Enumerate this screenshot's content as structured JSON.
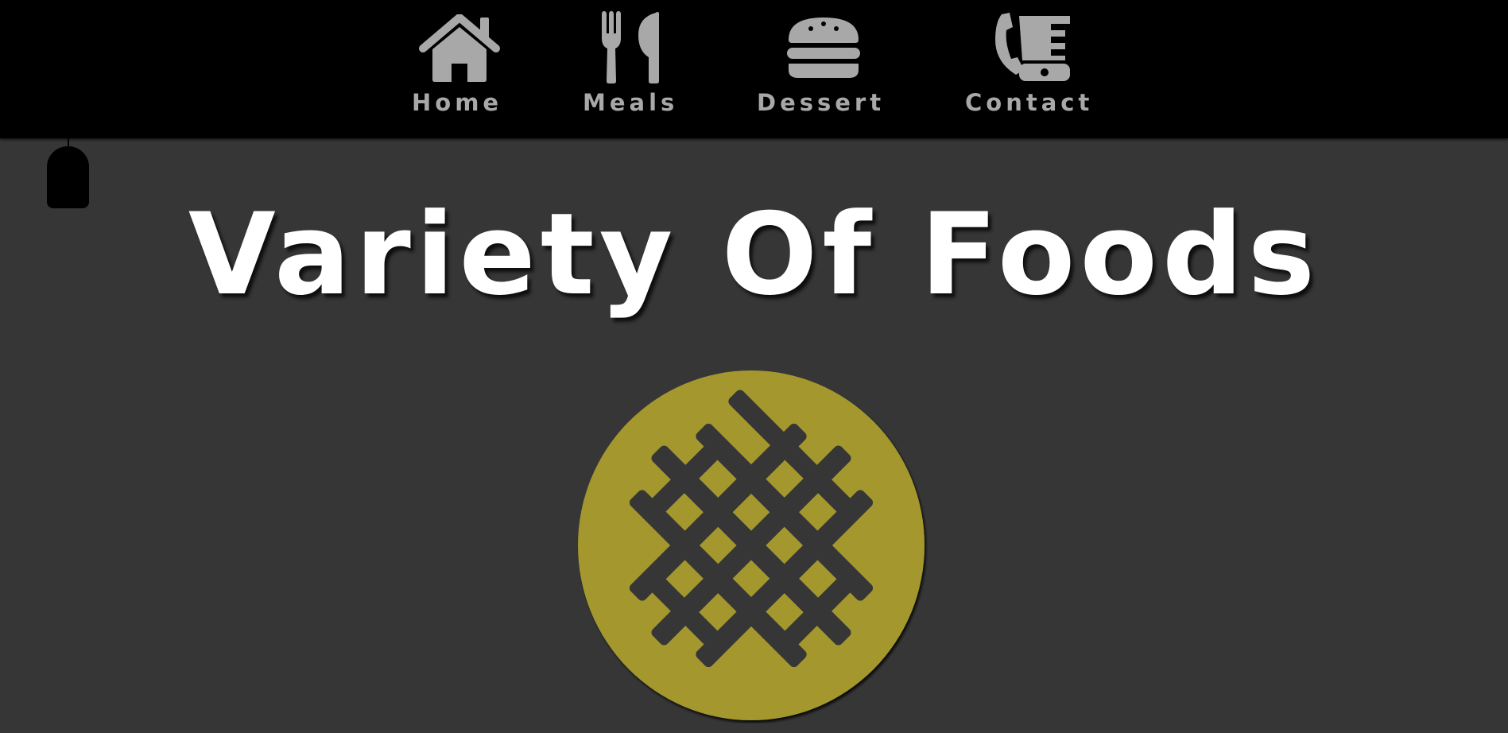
{
  "nav": {
    "items": [
      {
        "label": "Home",
        "icon": "home-icon"
      },
      {
        "label": "Meals",
        "icon": "fork-knife-icon"
      },
      {
        "label": "Dessert",
        "icon": "burger-icon"
      },
      {
        "label": "Contact",
        "icon": "phone-icon"
      }
    ]
  },
  "hero": {
    "title": "Variety Of Foods",
    "emblem_icon": "waffle-icon"
  },
  "colors": {
    "nav_background": "#000000",
    "page_background": "#363636",
    "nav_text": "#a8a8a8",
    "title_text": "#ffffff",
    "emblem": "#a3972f"
  }
}
